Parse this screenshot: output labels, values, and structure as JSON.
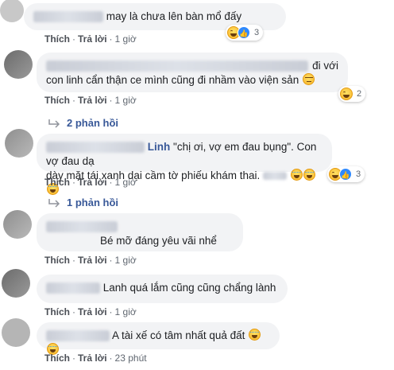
{
  "actions": {
    "like": "Thích",
    "reply": "Trả lời",
    "sep": "·"
  },
  "comments": [
    {
      "text": "may là chưa lên bàn mổ đấy",
      "time": "1 giờ",
      "reaction_count": "3"
    },
    {
      "text_line1": "đi với",
      "text_line2": "con linh cẩn thận ce mình cũng đi nhầm vào viện sản",
      "time": "1 giờ",
      "reaction_count": "2"
    },
    {
      "name_fragment": "Linh",
      "text_line1": "\"chị ơi, vợ em đau bụng\". Con vợ đau dạ",
      "text_line2": "dày mặt tái xanh dại cầm tờ phiếu khám thai.",
      "time": "1 giờ",
      "reaction_count": "3"
    },
    {
      "text": "Bé mỡ đáng yêu vãi nhể",
      "time": "1 giờ"
    },
    {
      "text": "Lanh quá lắm cũng cũng chẩng lành",
      "time": "1 giờ"
    },
    {
      "text": "A tài xế có tâm nhất quả đất",
      "time": "23 phút"
    }
  ],
  "replies": [
    {
      "label": "2 phản hồi"
    },
    {
      "label": "1 phản hồi"
    }
  ]
}
